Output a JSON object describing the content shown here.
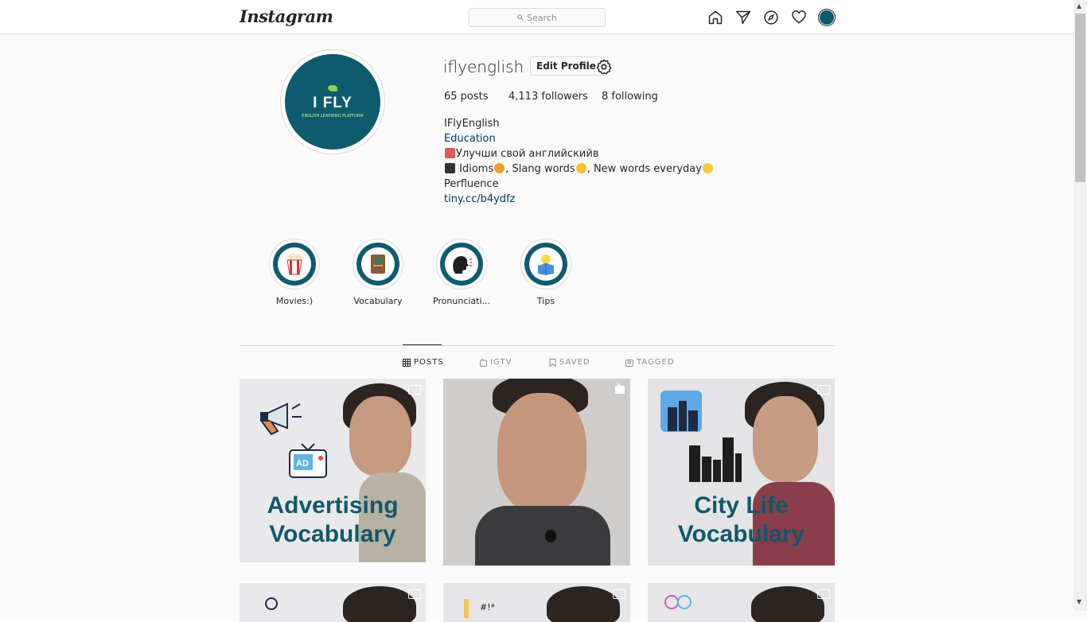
{
  "nav": {
    "logo": "Instagram",
    "search_placeholder": "Search",
    "icons": [
      "home-icon",
      "direct-icon",
      "explore-icon",
      "activity-icon",
      "profile-avatar"
    ]
  },
  "profile": {
    "username": "iflyenglish",
    "edit_label": "Edit Profile",
    "posts": "65 posts",
    "followers": "4,113 followers",
    "following": "8 following",
    "pic_brand": "I FLY",
    "pic_tagline": "ENGLISH LEARNING PLATFORM",
    "bio": {
      "name": "IFlyEnglish",
      "category": "Education",
      "line1": "Улучши свой английскийв",
      "line2_a": " Idioms",
      "line2_b": ", Slang words",
      "line2_c": ", New words everyday",
      "line3": "Perfluence",
      "link": "tiny.cc/b4ydfz"
    }
  },
  "highlights": [
    {
      "label": "Movies:)",
      "icon": "popcorn-icon"
    },
    {
      "label": "Vocabulary",
      "icon": "book-icon"
    },
    {
      "label": "Pronunciati...",
      "icon": "speaking-head-icon"
    },
    {
      "label": "Tips",
      "icon": "lightbulb-box-icon"
    }
  ],
  "tabs": [
    {
      "label": "POSTS",
      "active": true,
      "icon": "grid-icon"
    },
    {
      "label": "IGTV",
      "active": false,
      "icon": "igtv-icon"
    },
    {
      "label": "SAVED",
      "active": false,
      "icon": "bookmark-icon"
    },
    {
      "label": "TAGGED",
      "active": false,
      "icon": "tagged-icon"
    }
  ],
  "posts": [
    {
      "title_1": "Advertising",
      "title_2": "Vocabulary",
      "type": "video"
    },
    {
      "title_1": "",
      "title_2": "",
      "type": "igtv"
    },
    {
      "title_1": "City Life",
      "title_2": "Vocabulary",
      "type": "video"
    },
    {
      "title_1": "",
      "title_2": "",
      "type": "video"
    },
    {
      "title_1": "",
      "title_2": "",
      "type": "video"
    },
    {
      "title_1": "",
      "title_2": "",
      "type": "video"
    }
  ],
  "colors": {
    "brand": "#0f5b6e",
    "link": "#00376b",
    "border": "#dbdbdb"
  }
}
